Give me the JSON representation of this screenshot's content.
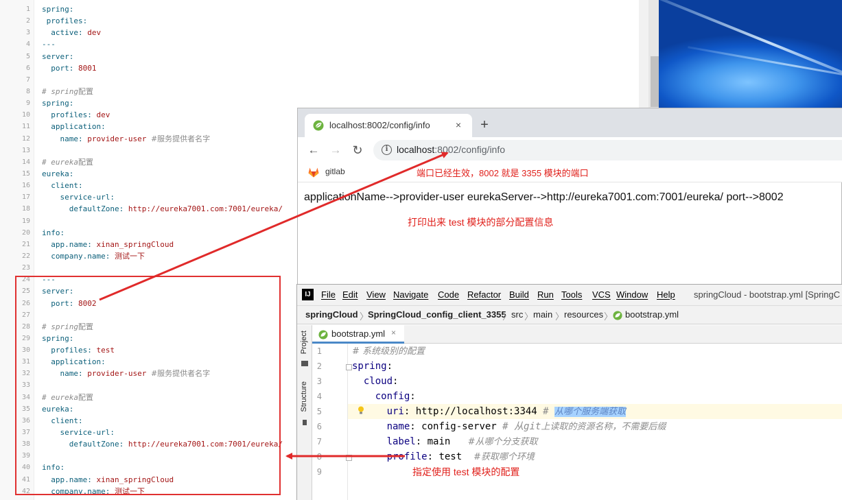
{
  "yaml_file": {
    "lines": [
      {
        "n": "1",
        "code": "spring:"
      },
      {
        "n": "2",
        "code": " profiles:"
      },
      {
        "n": "3",
        "key": "  active: ",
        "val": "dev"
      },
      {
        "n": "4",
        "code": "---"
      },
      {
        "n": "5",
        "code": "server:"
      },
      {
        "n": "6",
        "key": "  port: ",
        "val": "8001"
      },
      {
        "n": "7",
        "code": ""
      },
      {
        "n": "8",
        "cm": "# spring",
        "cmz": "配置"
      },
      {
        "n": "9",
        "code": "spring:"
      },
      {
        "n": "10",
        "key": "  profiles: ",
        "val": "dev"
      },
      {
        "n": "11",
        "code": "  application:"
      },
      {
        "n": "12",
        "key": "    name: ",
        "val": "provider-user ",
        "cmz": "#服务提供者名字"
      },
      {
        "n": "13",
        "code": ""
      },
      {
        "n": "14",
        "cm": "# eureka",
        "cmz": "配置"
      },
      {
        "n": "15",
        "code": "eureka:"
      },
      {
        "n": "16",
        "code": "  client:"
      },
      {
        "n": "17",
        "code": "    service-url:"
      },
      {
        "n": "18",
        "key": "      defaultZone: ",
        "val": "http://eureka7001.com:7001/eureka/"
      },
      {
        "n": "19",
        "code": ""
      },
      {
        "n": "20",
        "code": "info:"
      },
      {
        "n": "21",
        "key": "  app.name: ",
        "val": "xinan_springCloud"
      },
      {
        "n": "22",
        "key": "  company.name: ",
        "valz": "测试一下"
      },
      {
        "n": "23",
        "code": ""
      },
      {
        "n": "24",
        "code": "---"
      },
      {
        "n": "25",
        "code": "server:"
      },
      {
        "n": "26",
        "key": "  port: ",
        "val": "8002"
      },
      {
        "n": "27",
        "code": ""
      },
      {
        "n": "28",
        "cm": "# spring",
        "cmz": "配置"
      },
      {
        "n": "29",
        "code": "spring:"
      },
      {
        "n": "30",
        "key": "  profiles: ",
        "val": "test"
      },
      {
        "n": "31",
        "code": "  application:"
      },
      {
        "n": "32",
        "key": "    name: ",
        "val": "provider-user ",
        "cmz": "#服务提供者名字"
      },
      {
        "n": "33",
        "code": ""
      },
      {
        "n": "34",
        "cm": "# eureka",
        "cmz": "配置"
      },
      {
        "n": "35",
        "code": "eureka:"
      },
      {
        "n": "36",
        "code": "  client:"
      },
      {
        "n": "37",
        "code": "    service-url:"
      },
      {
        "n": "38",
        "key": "      defaultZone: ",
        "val": "http://eureka7001.com:7001/eureka/"
      },
      {
        "n": "39",
        "code": ""
      },
      {
        "n": "40",
        "code": "info:"
      },
      {
        "n": "41",
        "key": "  app.name: ",
        "val": "xinan_springCloud"
      },
      {
        "n": "42",
        "key": "  company.name: ",
        "valz": "测试一下"
      }
    ]
  },
  "browser": {
    "tab_title": "localhost:8002/config/info",
    "tab_close": "×",
    "new_tab": "+",
    "back": "←",
    "forward": "→",
    "reload": "↻",
    "info_icon": "i",
    "url_host": "localhost",
    "url_path": ":8002/config/info",
    "bookmark_label": "gitlab",
    "page_output": "applicationName-->provider-user eurekaServer-->http://eureka7001.com:7001/eureka/ port-->8002"
  },
  "annotations": {
    "port_note": "端口已经生效，8002 就是 3355 模块的端口",
    "print_note": "打印出来 test 模块的部分配置信息",
    "profile_note": "指定使用 test 模块的配置",
    "color": "#e0201b"
  },
  "ide": {
    "logo": "IJ",
    "menus": [
      "File",
      "Edit",
      "View",
      "Navigate",
      "Code",
      "Refactor",
      "Build",
      "Run",
      "Tools",
      "VCS",
      "Window",
      "Help"
    ],
    "window_title": "springCloud - bootstrap.yml [SpringC",
    "breadcrumbs": [
      "springCloud",
      "SpringCloud_config_client_3355",
      "src",
      "main",
      "resources",
      "bootstrap.yml"
    ],
    "side_tools": [
      "Project",
      "Structure"
    ],
    "file_tab": "bootstrap.yml",
    "file_tab_close": "×",
    "code": [
      {
        "n": "1",
        "indent": 0,
        "comment_zh": "# 系统级别的配置"
      },
      {
        "n": "2",
        "indent": 0,
        "key": "spring",
        "rest": ":"
      },
      {
        "n": "3",
        "indent": 2,
        "key": "cloud",
        "rest": ":"
      },
      {
        "n": "4",
        "indent": 4,
        "key": "config",
        "rest": ":"
      },
      {
        "n": "5",
        "indent": 6,
        "key": "uri",
        "rest": ": http://localhost:3344 ",
        "comment": "# ",
        "selected": "从哪个服务端获取"
      },
      {
        "n": "6",
        "indent": 6,
        "key": "name",
        "rest": ": config-server ",
        "comment": "# 从git",
        "comment_zh": "上读取的资源名称，不需要后缀"
      },
      {
        "n": "7",
        "indent": 6,
        "key": "label",
        "rest": ": main   ",
        "comment_zh": "#从哪个分支获取"
      },
      {
        "n": "8",
        "indent": 6,
        "key": "profile",
        "rest": ": test  ",
        "comment_zh": "#获取哪个环境"
      },
      {
        "n": "9",
        "indent": 0,
        "key": "",
        "rest": ""
      }
    ]
  }
}
